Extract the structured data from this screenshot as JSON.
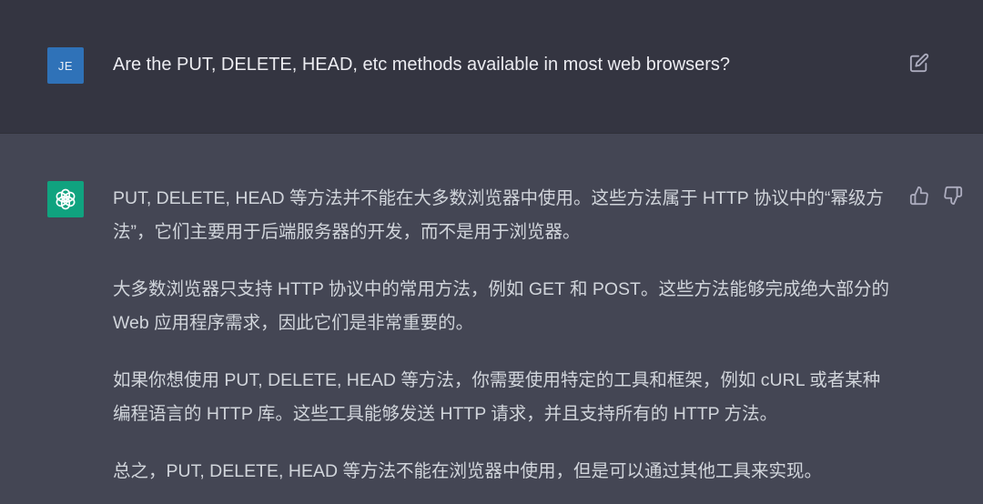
{
  "user_message": {
    "avatar_initials": "JE",
    "text": "Are the PUT, DELETE, HEAD, etc methods available in most web browsers?",
    "edit_icon": "edit-icon"
  },
  "assistant_message": {
    "avatar_icon": "openai-logo-icon",
    "paragraphs": [
      "PUT, DELETE, HEAD 等方法并不能在大多数浏览器中使用。这些方法属于 HTTP 协议中的“幂级方法”，它们主要用于后端服务器的开发，而不是用于浏览器。",
      "大多数浏览器只支持 HTTP 协议中的常用方法，例如 GET 和 POST。这些方法能够完成绝大部分的 Web 应用程序需求，因此它们是非常重要的。",
      "如果你想使用 PUT, DELETE, HEAD 等方法，你需要使用特定的工具和框架，例如 cURL 或者某种编程语言的 HTTP 库。这些工具能够发送 HTTP 请求，并且支持所有的 HTTP 方法。",
      "总之，PUT, DELETE, HEAD 等方法不能在浏览器中使用，但是可以通过其他工具来实现。"
    ],
    "feedback_icons": [
      "thumbs-up-icon",
      "thumbs-down-icon"
    ]
  },
  "colors": {
    "user_bg": "#343541",
    "assistant_bg": "#444654",
    "user_avatar": "#2f72b8",
    "bot_avatar": "#10a37f"
  }
}
